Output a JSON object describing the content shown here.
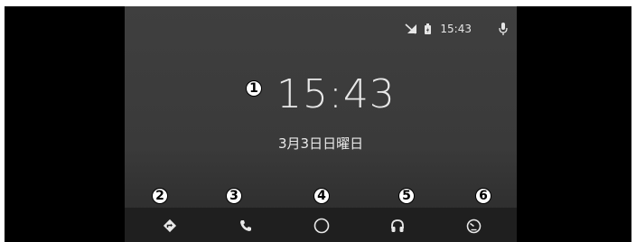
{
  "status_bar": {
    "time": "15:43",
    "icons": [
      "no-signal-icon",
      "battery-icon",
      "microphone-icon"
    ]
  },
  "home": {
    "clock": "15:43",
    "date": "3月3日日曜日"
  },
  "callouts": [
    "1",
    "2",
    "3",
    "4",
    "5",
    "6"
  ],
  "nav_bar": {
    "items": [
      {
        "icon": "navigation-icon"
      },
      {
        "icon": "phone-icon"
      },
      {
        "icon": "home-circle-icon"
      },
      {
        "icon": "headphones-icon"
      },
      {
        "icon": "dashboard-gauge-icon"
      }
    ]
  },
  "colors": {
    "screen_bg": "#3c3c3c",
    "nav_bg": "#1f1f1f",
    "text": "#e9e9e9"
  }
}
